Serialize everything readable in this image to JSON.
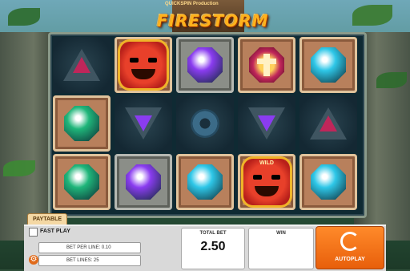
{
  "header": {
    "provider": "QUICKSPIN Production",
    "title": "FIRESTORM"
  },
  "colors": {
    "accent": "#ff7a1a",
    "ruby": "#c0265a",
    "emerald": "#1fb67a",
    "sapphire": "#2ec7e8",
    "amethyst": "#8a3cf0"
  },
  "reels": [
    [
      "tri-ruby-dark",
      "gem-emerald",
      "gem-emerald"
    ],
    [
      "mask-fire",
      "tri-amethyst-dark",
      "gem-amethyst"
    ],
    [
      "gem-amethyst",
      "eye-stone",
      "gem-sapphire"
    ],
    [
      "gem-ruby-cross",
      "tri-amethyst-dark",
      "mask-wild"
    ],
    [
      "gem-sapphire",
      "tri-ruby-dark",
      "gem-sapphire"
    ]
  ],
  "symbols": {
    "wild_label": "WILD"
  },
  "paytable_label": "PAYTABLE",
  "controls": {
    "fast_play_label": "FAST PLAY",
    "bet_per_line_label": "BET PER LINE:",
    "bet_per_line_value": "0.10",
    "bet_lines_label": "BET LINES:",
    "bet_lines_value": "25",
    "total_bet_label": "TOTAL BET",
    "total_bet_value": "2.50",
    "win_label": "WIN",
    "win_value": "",
    "autoplay_label": "AUTOPLAY"
  }
}
